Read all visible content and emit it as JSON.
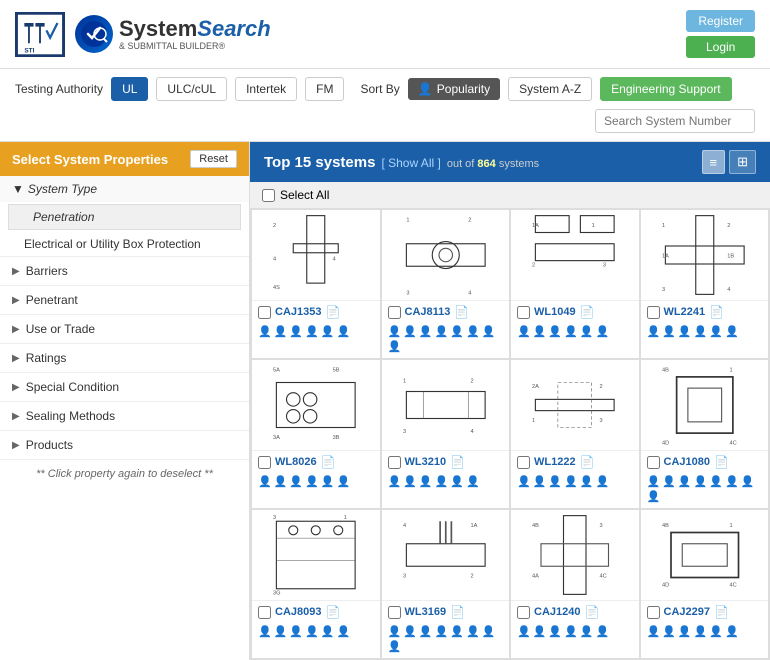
{
  "header": {
    "sti_label": "STI",
    "brand_name": "System",
    "brand_search": "Search",
    "brand_sub": "& SUBMITTAL BUILDER®",
    "register_label": "Register",
    "login_label": "Login"
  },
  "nav": {
    "testing_authority_label": "Testing Authority",
    "ul_label": "UL",
    "ulc_label": "ULC/cUL",
    "intertek_label": "Intertek",
    "fm_label": "FM",
    "sort_by_label": "Sort By",
    "popularity_label": "Popularity",
    "system_az_label": "System A-Z",
    "engineering_support_label": "Engineering Support",
    "search_placeholder": "Search System Number"
  },
  "sidebar": {
    "title": "Select System Properties",
    "reset_label": "Reset",
    "system_type_label": "System Type",
    "penetration_label": "Penetration",
    "electrical_label": "Electrical or Utility Box Protection",
    "items": [
      {
        "label": "Barriers"
      },
      {
        "label": "Penetrant"
      },
      {
        "label": "Use or Trade"
      },
      {
        "label": "Ratings"
      },
      {
        "label": "Special Condition"
      },
      {
        "label": "Sealing Methods"
      },
      {
        "label": "Products"
      }
    ],
    "note": "** Click property again to deselect **"
  },
  "content": {
    "top_label": "Top 15 systems",
    "show_all_label": "[ Show All ]",
    "out_of_label": "out of",
    "total": "864",
    "systems_label": "systems",
    "select_all_label": "Select All",
    "list_icon": "≡",
    "grid_icon": "⊞",
    "systems": [
      {
        "id": "CAJ1353",
        "persons": 6
      },
      {
        "id": "CAJ8113",
        "persons": 8
      },
      {
        "id": "WL1049",
        "persons": 6
      },
      {
        "id": "WL2241",
        "persons": 6
      },
      {
        "id": "WL8026",
        "persons": 6
      },
      {
        "id": "WL3210",
        "persons": 6
      },
      {
        "id": "WL1222",
        "persons": 6
      },
      {
        "id": "CAJ1080",
        "persons": 8
      },
      {
        "id": "CAJ8093",
        "persons": 6
      },
      {
        "id": "WL3169",
        "persons": 8
      },
      {
        "id": "CAJ1240",
        "persons": 6
      },
      {
        "id": "CAJ2297",
        "persons": 6
      }
    ]
  }
}
